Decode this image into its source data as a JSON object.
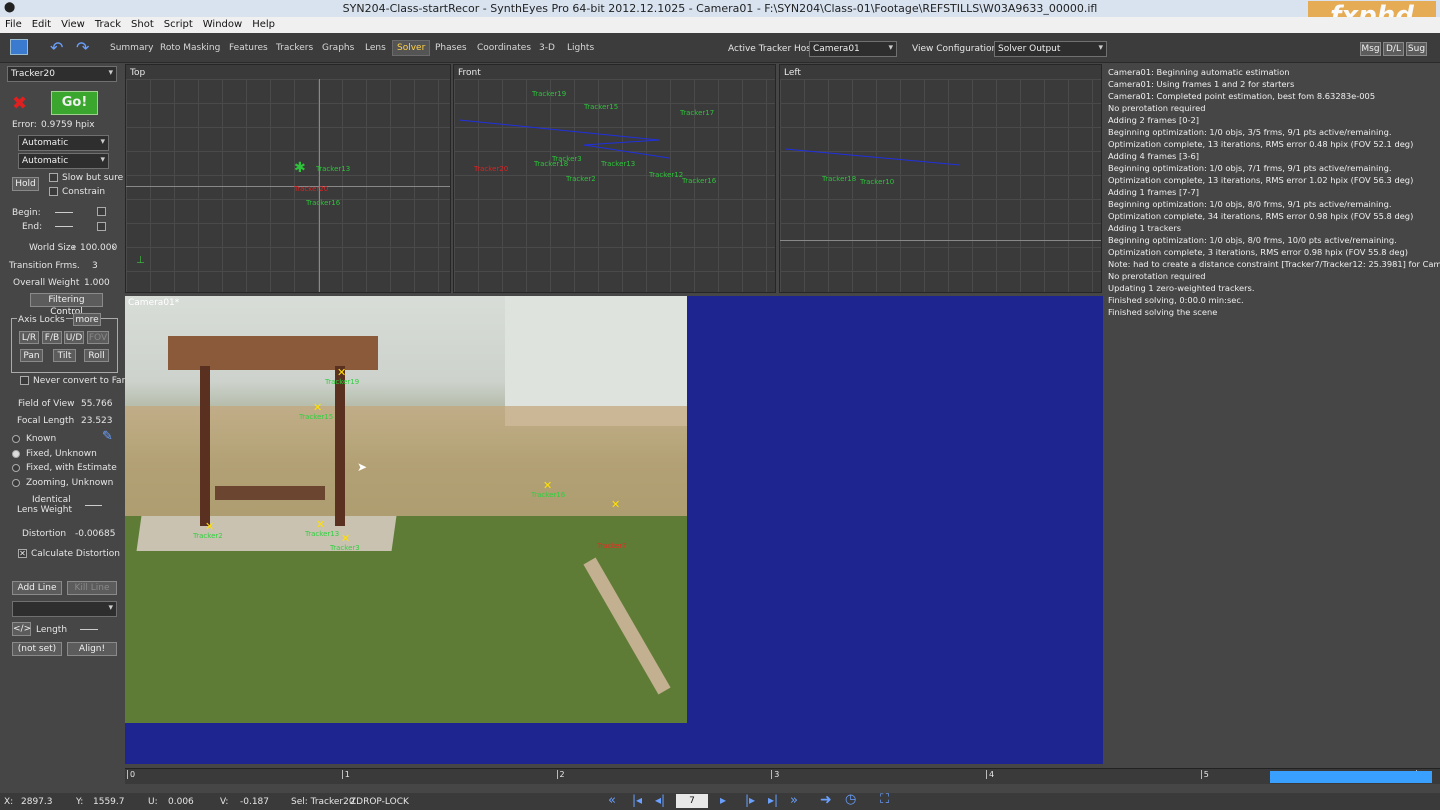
{
  "titlebar": {
    "title": "SYN204-Class-startRecor - SynthEyes Pro 64-bit 2012.12.1025 - Camera01 - F:\\SYN204\\Class-01\\Footage\\REFSTILLS\\W03A9633_00000.ifl",
    "watermark_url": "www.rrcg.cn",
    "logo": "fxphd"
  },
  "menu": [
    "File",
    "Edit",
    "View",
    "Track",
    "Shot",
    "Script",
    "Window",
    "Help"
  ],
  "toolbar": {
    "tabs": [
      "Summary",
      "Roto Masking",
      "Features",
      "Trackers",
      "Graphs",
      "Lens",
      "Solver",
      "Phases",
      "Coordinates",
      "3-D",
      "Lights"
    ],
    "active_tab": "Solver",
    "active_tracker_host_label": "Active Tracker Host:",
    "active_tracker_host_value": "Camera01",
    "view_config_label": "View Configuration:",
    "view_config_value": "Solver Output",
    "right_buttons": [
      "Msg",
      "D/L",
      "Sug"
    ]
  },
  "left": {
    "tracker_select": "Tracker20",
    "go": "Go!",
    "error_label": "Error:",
    "error_value": "0.9759 hpix",
    "mode1": "Automatic",
    "mode2": "Automatic",
    "hold": "Hold",
    "slow_but_sure": "Slow but sure",
    "constrain": "Constrain",
    "begin": "Begin:",
    "end": "End:",
    "world_size_label": "World Size",
    "world_size": "100.000",
    "transition_label": "Transition Frms.",
    "transition": "3",
    "overall_weight_label": "Overall Weight",
    "overall_weight": "1.000",
    "filtering": "Filtering Control",
    "axis_locks": "Axis Locks",
    "more": "more",
    "axis_buttons": [
      "L/R",
      "F/B",
      "U/D",
      "FOV"
    ],
    "axis_buttons2": [
      "Pan",
      "Tilt",
      "Roll"
    ],
    "never_convert": "Never convert to Far",
    "fov_label": "Field of View",
    "fov": "55.766",
    "focal_label": "Focal Length",
    "focal": "23.523",
    "lens_modes": [
      "Known",
      "Fixed, Unknown",
      "Fixed, with Estimate",
      "Zooming, Unknown"
    ],
    "identical": "Identical",
    "lens_weight": "Lens Weight",
    "distortion_label": "Distortion",
    "distortion": "-0.00685",
    "calc_distortion": "Calculate Distortion",
    "add_line": "Add Line",
    "kill_line": "Kill Line",
    "length": "Length",
    "not_set": "(not set)",
    "align": "Align!"
  },
  "viewports": {
    "top": {
      "name": "Top",
      "trackers": [
        "Tracker20",
        "Tracker13",
        "Tracker16"
      ]
    },
    "front": {
      "name": "Front",
      "trackers": [
        "Tracker19",
        "Tracker15",
        "Tracker17",
        "Tracker20",
        "Tracker18",
        "Tracker3",
        "Tracker13",
        "Tracker2",
        "Tracker12",
        "Tracker16"
      ]
    },
    "left": {
      "name": "Left",
      "trackers": [
        "Tracker18",
        "Tracker10"
      ]
    },
    "camera": {
      "name": "Camera01*",
      "trackers": [
        "Tracker19",
        "Tracker15",
        "Tracker16",
        "Tracker2",
        "Tracker13",
        "Tracker3",
        "Tracker7"
      ]
    }
  },
  "log": [
    "Camera01: Beginning automatic estimation",
    "Camera01: Using frames 1 and 2 for starters",
    "Camera01: Completed point estimation, best fom 8.63283e-005",
    "No prerotation required",
    "Adding 2 frames [0-2]",
    "Beginning optimization: 1/0 objs, 3/5 frms, 9/1 pts active/remaining.",
    "Optimization complete, 13 iterations, RMS error 0.48 hpix (FOV 52.1 deg)",
    "Adding 4 frames [3-6]",
    "Beginning optimization: 1/0 objs, 7/1 frms, 9/1 pts active/remaining.",
    "Optimization complete, 13 iterations, RMS error 1.02 hpix (FOV 56.3 deg)",
    "Adding 1 frames [7-7]",
    "Beginning optimization: 1/0 objs, 8/0 frms, 9/1 pts active/remaining.",
    "Optimization complete, 34 iterations, RMS error 0.98 hpix (FOV 55.8 deg)",
    "Adding 1 trackers",
    "Beginning optimization: 1/0 objs, 8/0 frms, 10/0 pts active/remaining.",
    "Optimization complete, 3 iterations, RMS error 0.98 hpix (FOV 55.8 deg)",
    "Note: had to create a distance constraint [Tracker7/Tracker12: 25.3981] for Camera01",
    "No prerotation required",
    "Updating 1 zero-weighted trackers.",
    "Finished solving, 0:00.0 min:sec.",
    "Finished solving the scene"
  ],
  "timeline": {
    "ticks": [
      "0",
      "1",
      "2",
      "3",
      "4",
      "5",
      "6"
    ]
  },
  "status": {
    "x_label": "X:",
    "x": "2897.3",
    "y_label": "Y:",
    "y": "1559.7",
    "u_label": "U:",
    "u": "0.006",
    "v_label": "V:",
    "v": "-0.187",
    "sel": "Sel: Tracker20",
    "zdrop": "ZDROP-LOCK",
    "frame": "7"
  },
  "colors": {
    "camera_bg": "#1e2590",
    "solver_tab": "#ffd24a",
    "go_button": "#3aa62e",
    "tracker_green": "#2ec33a",
    "tracker_yellow": "#ffe000"
  }
}
